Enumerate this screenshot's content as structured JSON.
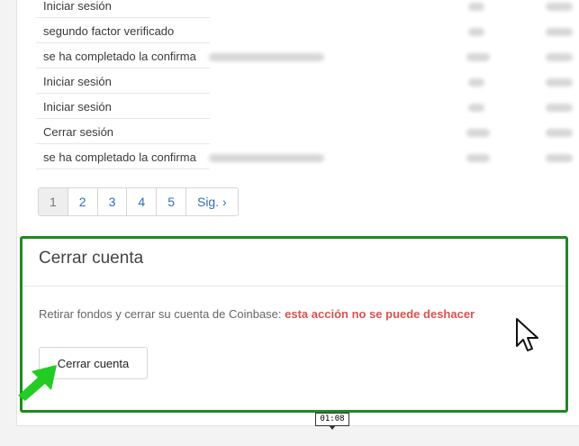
{
  "activity": {
    "events": [
      "Iniciar sesión",
      "segundo factor verificado",
      "se ha completado la confirma",
      "Iniciar sesión",
      "Iniciar sesión",
      "Cerrar sesión",
      "se ha completado la confirma"
    ]
  },
  "pagination": {
    "pages": [
      "1",
      "2",
      "3",
      "4",
      "5"
    ],
    "active": "1",
    "next_label": "Sig. ›"
  },
  "close_account": {
    "title": "Cerrar cuenta",
    "description": "Retirar fondos y cerrar su cuenta de Coinbase: ",
    "warning": "esta acción no se puede deshacer",
    "button_label": "Cerrar cuenta"
  },
  "recording": {
    "timestamp": "01:08"
  },
  "colors": {
    "highlight_border": "#1e8a1e",
    "warning_text": "#d9534f",
    "link": "#2f6fb5",
    "annotation_arrow": "#22cc22"
  },
  "icons": {
    "mouse_cursor": "mouse-pointer-icon",
    "annotation_arrow": "green-arrow-icon"
  }
}
